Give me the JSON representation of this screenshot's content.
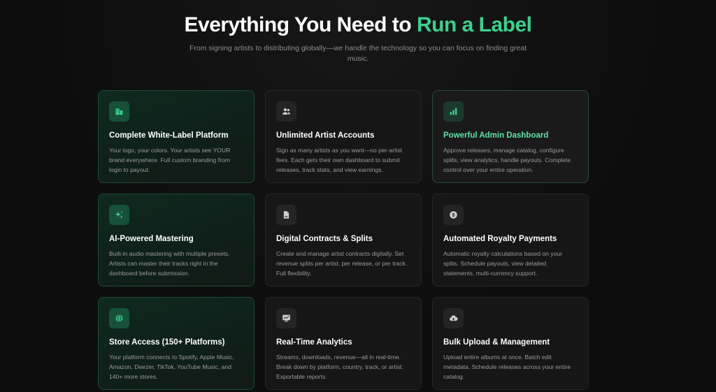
{
  "hero": {
    "title_main": "Everything You Need to ",
    "title_accent": "Run a Label",
    "subtitle": "From signing artists to distributing globally—we handle the technology so you can focus on finding great music."
  },
  "colors": {
    "accent": "#3ecf8e",
    "background": "#0d0d0d",
    "card": "#161616"
  },
  "features": [
    {
      "icon": "building-icon",
      "title": "Complete White-Label Platform",
      "description": "Your logo, your colors. Your artists see YOUR brand everywhere. Full custom branding from login to payout."
    },
    {
      "icon": "users-icon",
      "title": "Unlimited Artist Accounts",
      "description": "Sign as many artists as you want—no per-artist fees. Each gets their own dashboard to submit releases, track stats, and view earnings."
    },
    {
      "icon": "bar-chart-icon",
      "title": "Powerful Admin Dashboard",
      "description": "Approve releases, manage catalog, configure splits, view analytics, handle payouts. Complete control over your entire operation."
    },
    {
      "icon": "sparkles-icon",
      "title": "AI-Powered Mastering",
      "description": "Built-in audio mastering with multiple presets. Artists can master their tracks right in the dashboard before submission."
    },
    {
      "icon": "contract-icon",
      "title": "Digital Contracts & Splits",
      "description": "Create and manage artist contracts digitally. Set revenue splits per artist, per release, or per track. Full flexibility."
    },
    {
      "icon": "dollar-coin-icon",
      "title": "Automated Royalty Payments",
      "description": "Automatic royalty calculations based on your splits. Schedule payouts, view detailed statements, multi-currency support."
    },
    {
      "icon": "globe-icon",
      "title": "Store Access (150+ Platforms)",
      "description": "Your platform connects to Spotify, Apple Music, Amazon, Deezer, TikTok, YouTube Music, and 140+ more stores."
    },
    {
      "icon": "analytics-board-icon",
      "title": "Real-Time Analytics",
      "description": "Streams, downloads, revenue—all in real-time. Break down by platform, country, track, or artist. Exportable reports."
    },
    {
      "icon": "cloud-upload-icon",
      "title": "Bulk Upload & Management",
      "description": "Upload entire albums at once. Batch edit metadata. Schedule releases across your entire catalog."
    }
  ]
}
